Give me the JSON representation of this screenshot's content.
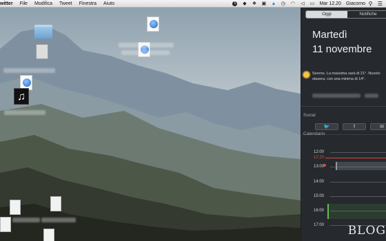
{
  "menubar": {
    "app_name": "witter",
    "items": [
      "File",
      "Modifica",
      "Tweet",
      "Finestra",
      "Aiuto"
    ],
    "clock": "Mar 12.20",
    "user": "Giacomo"
  },
  "notification_center": {
    "tabs": [
      {
        "label": "Oggi",
        "active": true
      },
      {
        "label": "Notifiche",
        "active": false
      }
    ],
    "day": "Martedì",
    "date": "11 novembre",
    "weather_text": "Sereno. La massima sarà di 21°. Nuvolo stasera, con una minima di 14°.",
    "social_header": "Social",
    "calendar_header": "Calendario",
    "calendar_times": [
      {
        "label": "12:00",
        "now": false
      },
      {
        "label": "12:20",
        "now": true
      },
      {
        "label": "13:00",
        "now": false
      },
      {
        "label": "14:00",
        "now": false
      },
      {
        "label": "15:00",
        "now": false
      },
      {
        "label": "16:00",
        "now": false
      },
      {
        "label": "17:00",
        "now": false
      }
    ]
  },
  "social_buttons": [
    {
      "icon": "twitter-icon",
      "glyph": "🐦"
    },
    {
      "icon": "facebook-icon",
      "glyph": "f"
    },
    {
      "icon": "messages-icon",
      "glyph": "✉"
    }
  ],
  "watermark": "BLOG"
}
